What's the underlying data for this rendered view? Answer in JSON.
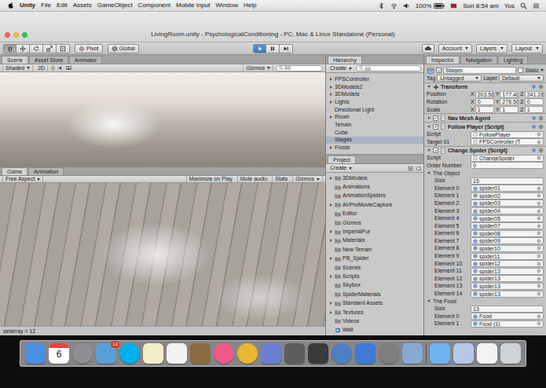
{
  "menubar": {
    "app": "Unity",
    "menus": [
      "File",
      "Edit",
      "Assets",
      "GameObject",
      "Component",
      "Mobile Input",
      "Window",
      "Help"
    ],
    "battery": "100%",
    "clock": "Sun 8:54 am",
    "user": "Yus"
  },
  "window": {
    "title": "LivingRoom.unity - PsychologicalConditioning - PC, Mac & Linux Standalone (Personal)"
  },
  "toolbar": {
    "tools": [
      {
        "kind": "hand",
        "selected": true
      },
      {
        "kind": "move",
        "selected": false
      },
      {
        "kind": "rotate",
        "selected": false
      },
      {
        "kind": "scale",
        "selected": false
      },
      {
        "kind": "rect",
        "selected": false
      }
    ],
    "pivot": "Pivot",
    "global": "Global",
    "playback": [
      {
        "kind": "play",
        "selected": true
      },
      {
        "kind": "pause",
        "selected": false
      },
      {
        "kind": "step",
        "selected": false
      }
    ],
    "menus": [
      "Account",
      "Layers",
      "Layout"
    ]
  },
  "scene": {
    "tabs": [
      {
        "label": "Scene",
        "selected": true
      },
      {
        "label": "Asset Store",
        "selected": false
      },
      {
        "label": "Animator",
        "selected": false
      }
    ],
    "shading": "Shaded",
    "mode": "2D",
    "gizmos": "Gizmos",
    "search": "All"
  },
  "game": {
    "tabs": [
      {
        "label": "Game",
        "selected": true
      },
      {
        "label": "Animation",
        "selected": false
      }
    ],
    "aspect": "Free Aspect",
    "toggles": [
      {
        "label": "Maximize on Play",
        "on": false
      },
      {
        "label": "Mute audio",
        "on": false
      },
      {
        "label": "Stats",
        "on": false
      }
    ],
    "gizmos": "Gizmos"
  },
  "status_bar": {
    "message": "setarray = 12"
  },
  "hierarchy": {
    "title": "Hierarchy",
    "create": "Create",
    "search": "All",
    "items": [
      {
        "label": "FPSController",
        "has_children": true,
        "selected": false
      },
      {
        "label": "3DModels2",
        "has_children": true,
        "selected": false
      },
      {
        "label": "3DModels",
        "has_children": true,
        "selected": false
      },
      {
        "label": "Lights",
        "has_children": true,
        "selected": false
      },
      {
        "label": "Directional Light",
        "has_children": false,
        "selected": false
      },
      {
        "label": "Room",
        "has_children": true,
        "selected": false
      },
      {
        "label": "Terrain",
        "has_children": false,
        "selected": false
      },
      {
        "label": "Cube",
        "has_children": false,
        "selected": false
      },
      {
        "label": "Stages",
        "has_children": false,
        "selected": true
      },
      {
        "label": "Foods",
        "has_children": true,
        "selected": false
      }
    ]
  },
  "project": {
    "title": "Project",
    "create": "Create",
    "items": [
      {
        "label": "3DModels",
        "kind": "folder",
        "has_children": true
      },
      {
        "label": "Animations",
        "kind": "folder",
        "has_children": false
      },
      {
        "label": "AnimationSpiders",
        "kind": "folder",
        "has_children": false
      },
      {
        "label": "AVProMovieCapture",
        "kind": "folder",
        "has_children": true
      },
      {
        "label": "Editor",
        "kind": "folder",
        "has_children": false
      },
      {
        "label": "Gizmos",
        "kind": "folder",
        "has_children": false
      },
      {
        "label": "ImperialFur",
        "kind": "folder",
        "has_children": true
      },
      {
        "label": "Materials",
        "kind": "folder",
        "has_children": true
      },
      {
        "label": "New Terrain",
        "kind": "folder",
        "has_children": false
      },
      {
        "label": "PB_Spider",
        "kind": "folder",
        "has_children": true
      },
      {
        "label": "Scenes",
        "kind": "folder",
        "has_children": false
      },
      {
        "label": "Scripts",
        "kind": "folder",
        "has_children": true
      },
      {
        "label": "Skybox",
        "kind": "folder",
        "has_children": false
      },
      {
        "label": "SpiderMaterials",
        "kind": "folder",
        "has_children": false
      },
      {
        "label": "Standard Assets",
        "kind": "folder",
        "has_children": true
      },
      {
        "label": "Textures",
        "kind": "folder",
        "has_children": true
      },
      {
        "label": "Videos",
        "kind": "folder",
        "has_children": false
      },
      {
        "label": "Wall",
        "kind": "scene",
        "has_children": false
      }
    ]
  },
  "inspector": {
    "tabs": [
      {
        "label": "Inspector",
        "selected": true
      },
      {
        "label": "Navigation",
        "selected": false
      },
      {
        "label": "Lighting",
        "selected": false
      }
    ],
    "object": {
      "name": "Stages",
      "active": true,
      "static_label": "Static",
      "static": false,
      "tag_label": "Tag",
      "tag": "Untagged",
      "layer_label": "Layer",
      "layer": "Default"
    },
    "transform": {
      "title": "Transform",
      "expanded": true,
      "axes": [
        "X",
        "Y",
        "Z"
      ],
      "rows": [
        {
          "label": "Position",
          "values": [
            "203.56",
            "177.40",
            "241.28"
          ]
        },
        {
          "label": "Rotation",
          "values": [
            "0",
            "276.50",
            "0"
          ]
        },
        {
          "label": "Scale",
          "values": [
            "1",
            "1",
            "1"
          ]
        }
      ]
    },
    "components": [
      {
        "title": "Nav Mesh Agent",
        "enabled": true,
        "expanded": false,
        "fields": [],
        "arrays": []
      },
      {
        "title": "Follow Player (Script)",
        "enabled": true,
        "expanded": true,
        "fields": [
          {
            "label": "Script",
            "value": "FollowPlayer",
            "kind": "object"
          },
          {
            "label": "Target 01",
            "value": "FPSController (T",
            "kind": "object"
          }
        ],
        "arrays": []
      },
      {
        "title": "Change Spider (Script)",
        "enabled": true,
        "expanded": true,
        "fields": [
          {
            "label": "Script",
            "value": "ChangeSpider",
            "kind": "object"
          },
          {
            "label": "Order Number",
            "value": "0",
            "kind": "number"
          }
        ],
        "arrays": [
          {
            "title": "The Object",
            "expanded": true,
            "size_label": "Size",
            "size": "15",
            "elements": [
              {
                "label": "Element 0",
                "value": "spider01"
              },
              {
                "label": "Element 1",
                "value": "spider02"
              },
              {
                "label": "Element 2",
                "value": "spider03"
              },
              {
                "label": "Element 3",
                "value": "spider04"
              },
              {
                "label": "Element 4",
                "value": "spider05"
              },
              {
                "label": "Element 5",
                "value": "spider07"
              },
              {
                "label": "Element 6",
                "value": "spider08"
              },
              {
                "label": "Element 7",
                "value": "spider09"
              },
              {
                "label": "Element 8",
                "value": "spider10"
              },
              {
                "label": "Element 9",
                "value": "spider11"
              },
              {
                "label": "Element 10",
                "value": "spider12"
              },
              {
                "label": "Element 11",
                "value": "spider13"
              },
              {
                "label": "Element 12",
                "value": "spider13"
              },
              {
                "label": "Element 13",
                "value": "spider13"
              },
              {
                "label": "Element 14",
                "value": "spider13"
              }
            ]
          },
          {
            "title": "The Food",
            "expanded": true,
            "size_label": "Size",
            "size": "13",
            "elements": [
              {
                "label": "Element 0",
                "value": "Food"
              },
              {
                "label": "Element 1",
                "value": "Food (1)"
              }
            ]
          }
        ]
      }
    ]
  },
  "dock": {
    "items": [
      {
        "kind": "app",
        "color": "#4a90e2"
      },
      {
        "kind": "calendar",
        "color": "#ffffff",
        "text": "6"
      },
      {
        "kind": "round",
        "color": "#8e8e93"
      },
      {
        "kind": "app",
        "color": "#5aa0d8",
        "badge": "12"
      },
      {
        "kind": "round",
        "color": "#00aff0"
      },
      {
        "kind": "app",
        "color": "#f4eec8"
      },
      {
        "kind": "app",
        "color": "#f2f2f2"
      },
      {
        "kind": "app",
        "color": "#8a6a3f"
      },
      {
        "kind": "round",
        "color": "#f05a8a"
      },
      {
        "kind": "round",
        "color": "#e8b830"
      },
      {
        "kind": "app",
        "color": "#6a7fd0"
      },
      {
        "kind": "app",
        "color": "#5d5d5d"
      },
      {
        "kind": "app",
        "color": "#3a3a3a"
      },
      {
        "kind": "round",
        "color": "#4d7fc2"
      },
      {
        "kind": "app",
        "color": "#3f7ad6"
      },
      {
        "kind": "round",
        "color": "#7d7d7d"
      },
      {
        "kind": "app",
        "color": "#88a9d4"
      },
      {
        "kind": "separator",
        "color": "#555555"
      },
      {
        "kind": "app",
        "color": "#6fb3f0"
      },
      {
        "kind": "app",
        "color": "#b5c8e8"
      },
      {
        "kind": "app",
        "color": "#f3f3f3"
      },
      {
        "kind": "app",
        "color": "#cfd3d6"
      }
    ]
  }
}
